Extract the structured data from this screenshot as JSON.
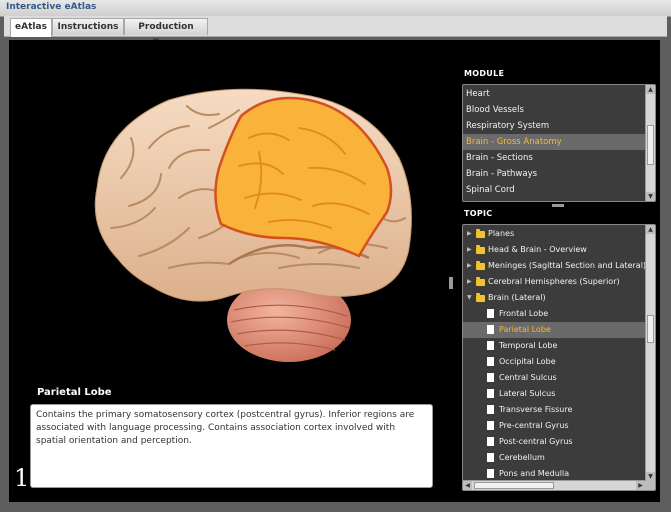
{
  "window": {
    "title": "Interactive eAtlas"
  },
  "tabs": [
    {
      "label": "eAtlas",
      "active": true
    },
    {
      "label": "Instructions",
      "active": false
    },
    {
      "label": "Production Team",
      "active": false
    }
  ],
  "module": {
    "heading": "MODULE",
    "items": [
      "Heart",
      "Blood Vessels",
      "Respiratory System",
      "Brain - Gross Anatomy",
      "Brain - Sections",
      "Brain - Pathways",
      "Spinal Cord"
    ],
    "selected_index": 3
  },
  "topic": {
    "heading": "TOPIC",
    "folders": [
      {
        "label": "Planes",
        "expanded": false
      },
      {
        "label": "Head & Brain - Overview",
        "expanded": false
      },
      {
        "label": "Meninges (Sagittal Section and Lateral)",
        "expanded": false
      },
      {
        "label": "Cerebral Hemispheres (Superior)",
        "expanded": false
      },
      {
        "label": "Brain (Lateral)",
        "expanded": true
      }
    ],
    "children": [
      "Frontal Lobe",
      "Parietal Lobe",
      "Temporal Lobe",
      "Occipital Lobe",
      "Central Sulcus",
      "Lateral Sulcus",
      "Transverse Fissure",
      "Pre-central Gyrus",
      "Post-central Gyrus",
      "Cerebellum",
      "Pons and Medulla"
    ],
    "selected_child": "Parietal Lobe"
  },
  "detail": {
    "title": "Parietal Lobe",
    "description": "Contains the primary somatosensory cortex (postcentral gyrus). Inferior regions are associated with language processing. Contains association cortex involved with spatial orientation and perception."
  },
  "figure_number": "1",
  "colors": {
    "highlight_text": "#f4b740",
    "parietal_highlight": "#f9b23a",
    "cortex": "#e9c4a2",
    "cerebellum": "#de8f7a",
    "stage_background": "#000000"
  }
}
